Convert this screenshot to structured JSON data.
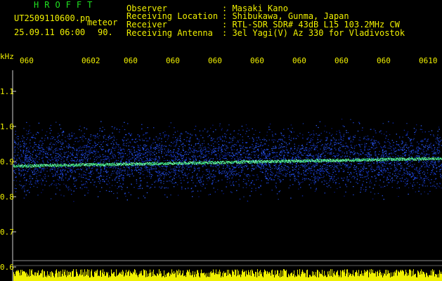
{
  "header": {
    "brand": "HROFFT",
    "filename": "UT2509110600.pn",
    "mode": "meteor",
    "datetime": "25.09.11 06:00",
    "count": "90."
  },
  "station": {
    "rows": [
      {
        "key": "Observer",
        "value": ": Masaki Kano"
      },
      {
        "key": "Receiving Location",
        "value": ": Shibukawa, Gunma, Japan"
      },
      {
        "key": "Receiver",
        "value": ": RTL-SDR SDR# 43dB L15 103.2MHz CW"
      },
      {
        "key": "Receiving Antenna",
        "value": ": 3el Yagi(V) Az 330 for Vladivostok"
      }
    ]
  },
  "axes": {
    "y_unit": "kHz",
    "y_ticks": [
      "1.1",
      "1.0",
      "0.9",
      "0.8",
      "0.7",
      "0.6"
    ],
    "x_ticks": [
      "060",
      "0602",
      "060",
      "060",
      "060",
      "060",
      "060",
      "060",
      "060",
      "0610"
    ]
  },
  "colors": {
    "text": "#f0f000",
    "brand": "#20e020",
    "noise": "#1030c0",
    "signal": "#40ff80",
    "bars": "#f0f000"
  }
}
